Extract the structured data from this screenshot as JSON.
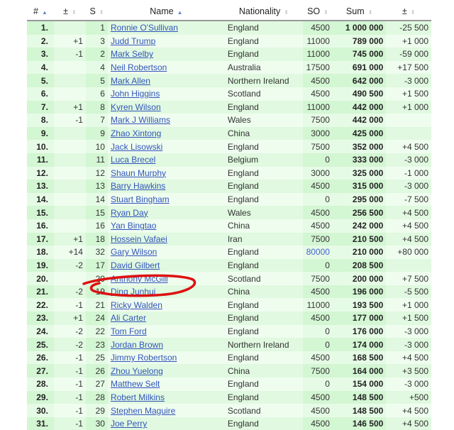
{
  "headers": [
    "#",
    "±",
    "S",
    "Name",
    "Nationality",
    "SO",
    "Sum",
    "±"
  ],
  "sort_icons": [
    "sort-asc-icon",
    "sort-icon",
    "sort-icon",
    "sort-asc-icon",
    "sort-icon",
    "sort-icon",
    "sort-icon",
    "sort-icon"
  ],
  "highlight": {
    "color": "#dd1111",
    "target_row": "Ding Junhui"
  },
  "rows": [
    [
      "1.",
      "",
      "1",
      "Ronnie O'Sullivan",
      "England",
      "4500",
      "1 000 000",
      "-25 500"
    ],
    [
      "2.",
      "+1",
      "3",
      "Judd Trump",
      "England",
      "11000",
      "789 000",
      "+1 000"
    ],
    [
      "3.",
      "-1",
      "2",
      "Mark Selby",
      "England",
      "11000",
      "745 000",
      "-59 000"
    ],
    [
      "4.",
      "",
      "4",
      "Neil Robertson",
      "Australia",
      "17500",
      "691 000",
      "+17 500"
    ],
    [
      "5.",
      "",
      "5",
      "Mark Allen",
      "Northern Ireland",
      "4500",
      "642 000",
      "-3 000"
    ],
    [
      "6.",
      "",
      "6",
      "John Higgins",
      "Scotland",
      "4500",
      "490 500",
      "+1 500"
    ],
    [
      "7.",
      "+1",
      "8",
      "Kyren Wilson",
      "England",
      "11000",
      "442 000",
      "+1 000"
    ],
    [
      "8.",
      "-1",
      "7",
      "Mark J Williams",
      "Wales",
      "7500",
      "442 000",
      ""
    ],
    [
      "9.",
      "",
      "9",
      "Zhao Xintong",
      "China",
      "3000",
      "425 000",
      ""
    ],
    [
      "10.",
      "",
      "10",
      "Jack Lisowski",
      "England",
      "7500",
      "352 000",
      "+4 500"
    ],
    [
      "11.",
      "",
      "11",
      "Luca Brecel",
      "Belgium",
      "0",
      "333 000",
      "-3 000"
    ],
    [
      "12.",
      "",
      "12",
      "Shaun Murphy",
      "England",
      "3000",
      "325 000",
      "-1 000"
    ],
    [
      "13.",
      "",
      "13",
      "Barry Hawkins",
      "England",
      "4500",
      "315 000",
      "-3 000"
    ],
    [
      "14.",
      "",
      "14",
      "Stuart Bingham",
      "England",
      "0",
      "295 000",
      "-7 500"
    ],
    [
      "15.",
      "",
      "15",
      "Ryan Day",
      "Wales",
      "4500",
      "256 500",
      "+4 500"
    ],
    [
      "16.",
      "",
      "16",
      "Yan Bingtao",
      "China",
      "4500",
      "242 000",
      "+4 500"
    ],
    [
      "17.",
      "+1",
      "18",
      "Hossein Vafaei",
      "Iran",
      "7500",
      "210 500",
      "+4 500"
    ],
    [
      "18.",
      "+14",
      "32",
      "Gary Wilson",
      "England",
      "80000",
      "210 000",
      "+80 000"
    ],
    [
      "19.",
      "-2",
      "17",
      "David Gilbert",
      "England",
      "0",
      "208 500",
      ""
    ],
    [
      "20.",
      "",
      "20",
      "Anthony McGill",
      "Scotland",
      "7500",
      "200 000",
      "+7 500"
    ],
    [
      "21.",
      "-2",
      "19",
      "Ding Junhui",
      "China",
      "4500",
      "196 000",
      "-5 500"
    ],
    [
      "22.",
      "-1",
      "21",
      "Ricky Walden",
      "England",
      "11000",
      "193 500",
      "+1 000"
    ],
    [
      "23.",
      "+1",
      "24",
      "Ali Carter",
      "England",
      "4500",
      "177 000",
      "+1 500"
    ],
    [
      "24.",
      "-2",
      "22",
      "Tom Ford",
      "England",
      "0",
      "176 000",
      "-3 000"
    ],
    [
      "25.",
      "-2",
      "23",
      "Jordan Brown",
      "Northern Ireland",
      "0",
      "174 000",
      "-3 000"
    ],
    [
      "26.",
      "-1",
      "25",
      "Jimmy Robertson",
      "England",
      "4500",
      "168 500",
      "+4 500"
    ],
    [
      "27.",
      "-1",
      "26",
      "Zhou Yuelong",
      "China",
      "7500",
      "164 000",
      "+3 500"
    ],
    [
      "28.",
      "-1",
      "27",
      "Matthew Selt",
      "England",
      "0",
      "154 000",
      "-3 000"
    ],
    [
      "29.",
      "-1",
      "28",
      "Robert Milkins",
      "England",
      "4500",
      "148 500",
      "+500"
    ],
    [
      "30.",
      "-1",
      "29",
      "Stephen Maguire",
      "Scotland",
      "4500",
      "148 500",
      "+4 500"
    ],
    [
      "31.",
      "-1",
      "30",
      "Joe Perry",
      "England",
      "4500",
      "146 500",
      "+4 500"
    ]
  ]
}
